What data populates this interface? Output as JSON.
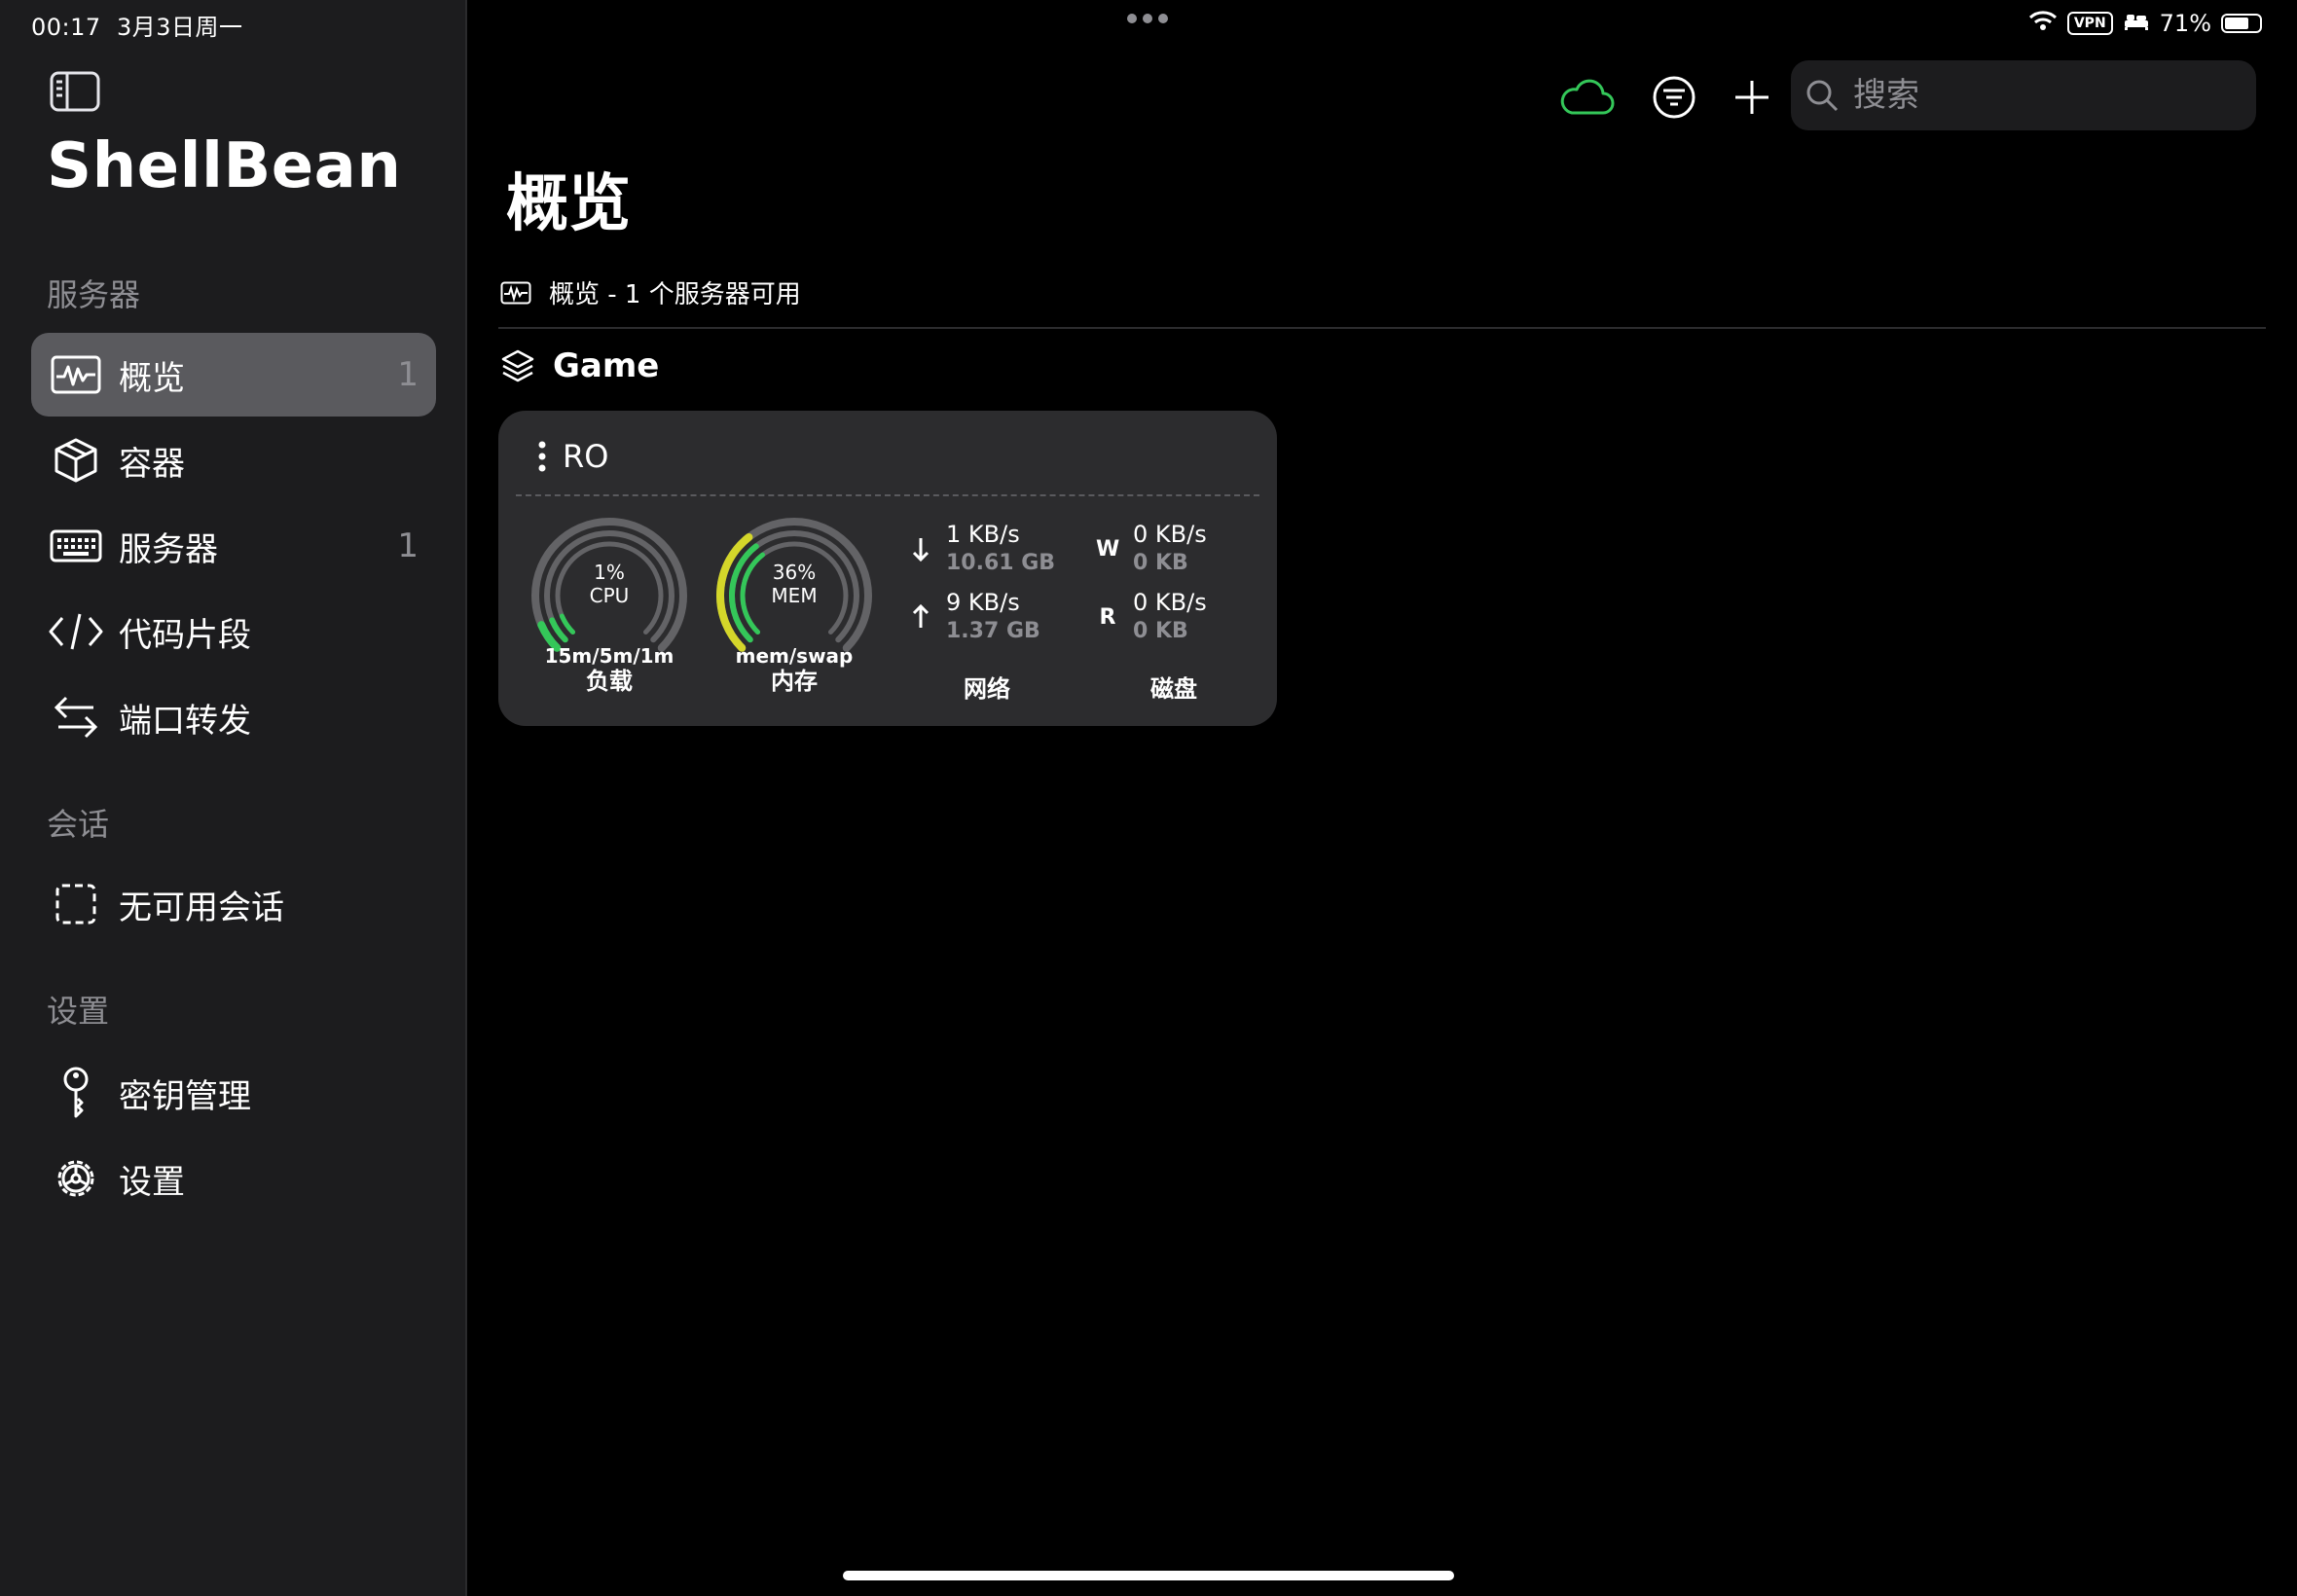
{
  "status": {
    "time": "00:17",
    "date": "3月3日周一",
    "vpn": "VPN",
    "battery": "71%",
    "battery_level": 0.71
  },
  "sidebar": {
    "title": "ShellBean",
    "sections": {
      "servers": "服务器",
      "sessions": "会话",
      "settings": "设置"
    },
    "items": [
      {
        "label": "概览",
        "count": "1",
        "icon": "waveform-icon",
        "selected": true
      },
      {
        "label": "容器",
        "count": "",
        "icon": "cube-icon"
      },
      {
        "label": "服务器",
        "count": "1",
        "icon": "keyboard-icon"
      },
      {
        "label": "代码片段",
        "count": "",
        "icon": "code-icon"
      },
      {
        "label": "端口转发",
        "count": "",
        "icon": "arrows-icon"
      }
    ],
    "session_items": [
      {
        "label": "无可用会话",
        "icon": "dashed-square-icon"
      }
    ],
    "settings_items": [
      {
        "label": "密钥管理",
        "icon": "key-icon"
      },
      {
        "label": "设置",
        "icon": "gear-icon"
      }
    ]
  },
  "toolbar": {
    "search_placeholder": "搜索",
    "cloud_color": "#34c759"
  },
  "main": {
    "title": "概览",
    "subtitle": "概览 - 1 个服务器可用",
    "group": "Game",
    "server": {
      "name": "RO",
      "cpu": {
        "percent_label": "1%",
        "name": "CPU",
        "sub": "15m/5m/1m",
        "label": "负载",
        "value": 1
      },
      "mem": {
        "percent_label": "36%",
        "name": "MEM",
        "sub": "mem/swap",
        "label": "内存",
        "value": 36
      },
      "network": {
        "down_rate": "1 KB/s",
        "down_total": "10.61 GB",
        "up_rate": "9 KB/s",
        "up_total": "1.37 GB",
        "label": "网络"
      },
      "disk": {
        "w_tag": "W",
        "w_rate": "0 KB/s",
        "w_total": "0 KB",
        "r_tag": "R",
        "r_rate": "0 KB/s",
        "r_total": "0 KB",
        "label": "磁盘"
      }
    }
  }
}
